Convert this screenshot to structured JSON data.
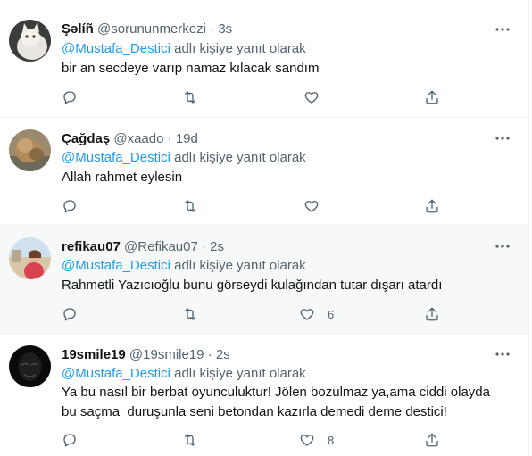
{
  "tweets": [
    {
      "name": "Şəlíñ",
      "handle": "@sorununmerkezi",
      "dot": "·",
      "time": "3s",
      "reply_mention": "@Mustafa_Destici",
      "reply_suffix": " adlı kişiye yanıt olarak",
      "text": "bir an secdeye varıp namaz kılacak sandım",
      "likes": ""
    },
    {
      "name": "Çağdaş",
      "handle": "@xaado",
      "dot": "·",
      "time": "19d",
      "reply_mention": "@Mustafa_Destici",
      "reply_suffix": " adlı kişiye yanıt olarak",
      "text": "Allah rahmet eylesin",
      "likes": ""
    },
    {
      "name": "refikau07",
      "handle": "@Refikau07",
      "dot": "·",
      "time": "2s",
      "reply_mention": "@Mustafa_Destici",
      "reply_suffix": " adlı kişiye yanıt olarak",
      "text": "Rahmetli Yazıcıoğlu bunu görseydi kulağından tutar dışarı atardı",
      "likes": "6"
    },
    {
      "name": "19smile19",
      "handle": "@19smile19",
      "dot": "·",
      "time": "2s",
      "reply_mention": "@Mustafa_Destici",
      "reply_suffix": " adlı kişiye yanıt olarak",
      "text": "Ya bu nasıl bir berbat oyunculuktur! Jölen bozulmaz ya,ama ciddi olayda bu saçma  duruşunla seni betondan kazırla demedi deme destici!",
      "likes": "8"
    }
  ],
  "icons": {
    "more": "more-horizontal-icon",
    "reply": "reply-icon",
    "retweet": "retweet-icon",
    "like": "heart-icon",
    "share": "share-icon"
  },
  "colors": {
    "accent": "#1d9bf0",
    "secondary_text": "#536471",
    "highlight_bg": "#f7f9f9"
  }
}
